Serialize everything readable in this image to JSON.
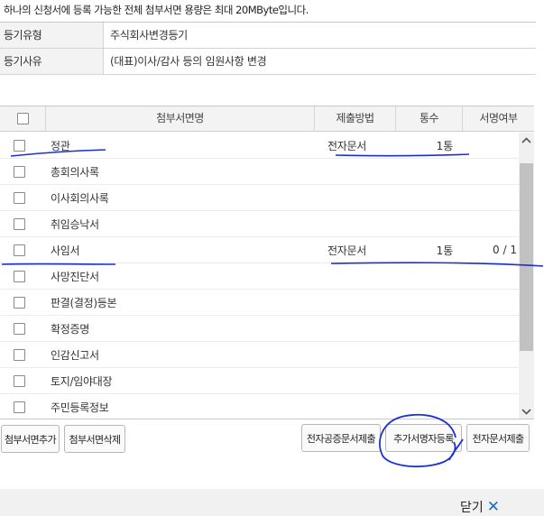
{
  "notice": "하나의 신청서에 등록 가능한 전체 첨부서면 용량은 최대 20MByte입니다.",
  "info": [
    {
      "label": "등기유형",
      "value": "주식회사변경등기"
    },
    {
      "label": "등기사유",
      "value": "(대표)이사/감사 등의 임원사항 변경"
    }
  ],
  "grid": {
    "headers": {
      "name": "첨부서면명",
      "method": "제출방법",
      "count": "통수",
      "sign": "서명여부"
    },
    "rows": [
      {
        "name": "정관",
        "method": "전자문서",
        "count": "1통",
        "sign": ""
      },
      {
        "name": "총회의사록",
        "method": "",
        "count": "",
        "sign": ""
      },
      {
        "name": "이사회의사록",
        "method": "",
        "count": "",
        "sign": ""
      },
      {
        "name": "취임승낙서",
        "method": "",
        "count": "",
        "sign": ""
      },
      {
        "name": "사임서",
        "method": "전자문서",
        "count": "1통",
        "sign": "0 / 1"
      },
      {
        "name": "사망진단서",
        "method": "",
        "count": "",
        "sign": ""
      },
      {
        "name": "판결(결정)등본",
        "method": "",
        "count": "",
        "sign": ""
      },
      {
        "name": "확정증명",
        "method": "",
        "count": "",
        "sign": ""
      },
      {
        "name": "인감신고서",
        "method": "",
        "count": "",
        "sign": ""
      },
      {
        "name": "토지/임야대장",
        "method": "",
        "count": "",
        "sign": ""
      },
      {
        "name": "주민등록정보",
        "method": "",
        "count": "",
        "sign": ""
      }
    ]
  },
  "buttons": {
    "add_doc": "첨부서면추가",
    "delete_doc": "첨부서면삭제",
    "notarized_submit": "전자공증문서제출",
    "add_signer": "추가서명자등록",
    "edoc_submit": "전자문서제출"
  },
  "footer": {
    "close_label": "닫기"
  },
  "colors": {
    "annotation": "#1a2fd6",
    "close_icon": "#1a6fc4"
  }
}
